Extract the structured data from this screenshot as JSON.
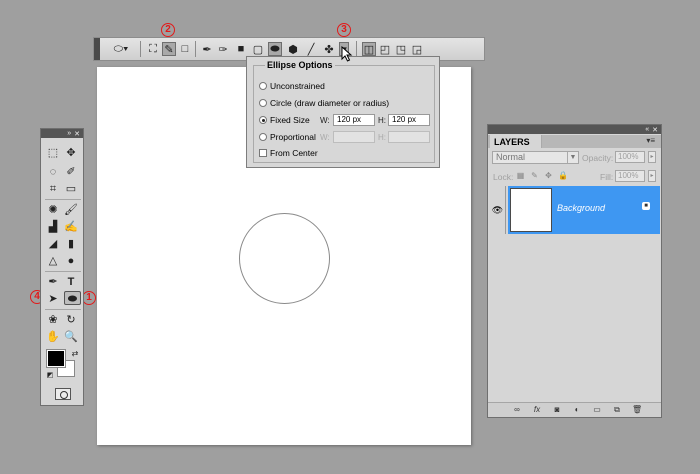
{
  "options_bar": {
    "shape_preset_icon": "ellipse-preset-icon",
    "mode_buttons": [
      "shape-layers-icon",
      "paths-icon",
      "fill-pixels-icon"
    ],
    "tool_buttons": [
      "pen-icon",
      "freeform-pen-icon",
      "rectangle-icon",
      "rounded-rectangle-icon",
      "ellipse-icon",
      "polygon-icon",
      "line-icon",
      "custom-shape-icon",
      "geometry-options-arrow-icon"
    ],
    "combine_buttons": [
      "create-new-shape-icon",
      "add-icon",
      "subtract-icon",
      "intersect-icon"
    ]
  },
  "annotations": {
    "one": "1",
    "two": "2",
    "three": "3",
    "four": "4",
    "color": "#e21a1a"
  },
  "ellipse_options": {
    "title": "Ellipse Options",
    "unconstrained": "Unconstrained",
    "circle": "Circle (draw diameter or radius)",
    "fixed_size": "Fixed Size",
    "w_label": "W:",
    "w_value": "120 px",
    "h_label": "H:",
    "h_value": "120 px",
    "proportional": "Proportional",
    "prop_w_label": "W:",
    "prop_h_label": "H:",
    "from_center": "From Center",
    "selected": "fixed_size"
  },
  "tools_panel": {
    "tools": [
      "marquee-icon",
      "move-icon",
      "lasso-icon",
      "quick-selection-icon",
      "crop-icon",
      "ruler-icon",
      "spot-healing-icon",
      "brush-icon",
      "clone-stamp-icon",
      "history-brush-icon",
      "eraser-icon",
      "gradient-icon",
      "blur-icon",
      "dodge-icon",
      "pen-icon",
      "type-icon",
      "path-selection-icon",
      "ellipse-tool-icon",
      "3d-rotate-icon",
      "3d-orbit-icon",
      "hand-icon",
      "zoom-icon"
    ],
    "foreground_color": "#000000",
    "background_color": "#ffffff"
  },
  "layers_panel": {
    "tab": "LAYERS",
    "blend_mode": "Normal",
    "opacity_label": "Opacity:",
    "opacity_value": "100%",
    "lock_label": "Lock:",
    "fill_label": "Fill:",
    "fill_value": "100%",
    "layer_name": "Background",
    "highlight_color": "#3e97f2",
    "footer_icons": [
      "link-icon",
      "fx-icon",
      "mask-icon",
      "adjustment-icon",
      "group-icon",
      "new-layer-icon",
      "delete-icon"
    ]
  }
}
